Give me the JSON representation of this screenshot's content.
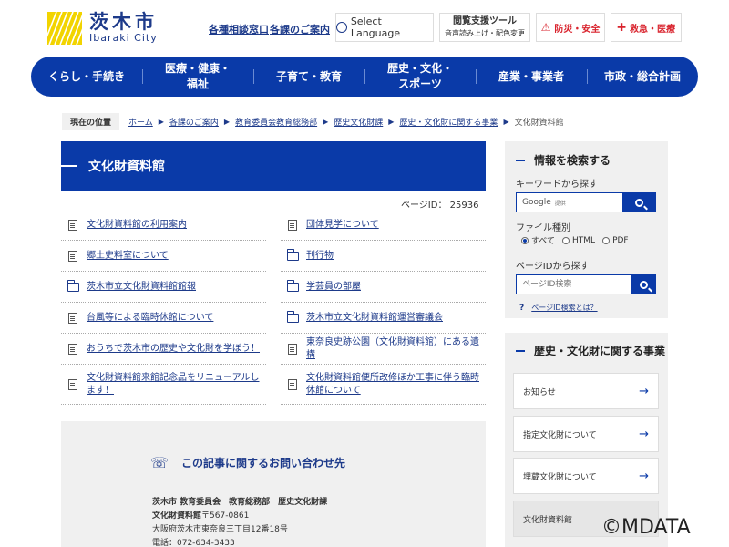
{
  "header": {
    "logo_jp": "茨木市",
    "logo_en": "Ibaraki City",
    "links": [
      "各種相談窓口",
      "各課のご案内"
    ],
    "select_language": "Select Language",
    "tool_line1": "閲覧支援ツール",
    "tool_line2": "音声読み上げ・配色変更",
    "safety": "防災・安全",
    "emergency": "救急・医療"
  },
  "nav": {
    "items": [
      "くらし・手続き",
      "医療・健康・\n福祉",
      "子育て・教育",
      "歴史・文化・\nスポーツ",
      "産業・事業者",
      "市政・総合計画"
    ]
  },
  "breadcrumb": {
    "here_label": "現在の位置",
    "links": [
      "ホーム",
      "各課のご案内",
      "教育委員会教育総務部",
      "歴史文化財課",
      "歴史・文化財に関する事業"
    ],
    "current": "文化財資料館"
  },
  "main": {
    "title": "文化財資料館",
    "page_id": "ページID： 25936",
    "links": [
      {
        "text": "文化財資料館の利用案内",
        "icon": "doc"
      },
      {
        "text": "団体見学について",
        "icon": "doc"
      },
      {
        "text": "郷土史料室について",
        "icon": "doc"
      },
      {
        "text": "刊行物",
        "icon": "folder"
      },
      {
        "text": "茨木市立文化財資料館館報",
        "icon": "folder"
      },
      {
        "text": "学芸員の部屋",
        "icon": "folder"
      },
      {
        "text": "台風等による臨時休館について",
        "icon": "doc"
      },
      {
        "text": "茨木市立文化財資料館運営審議会",
        "icon": "folder"
      },
      {
        "text": "おうちで茨木市の歴史や文化財を学ぼう！",
        "icon": "doc"
      },
      {
        "text": "東奈良史跡公園（文化財資料館）にある遺構",
        "icon": "doc"
      },
      {
        "text": "文化財資料館来館記念品をリニューアルします！",
        "icon": "doc"
      },
      {
        "text": "文化財資料館便所改修ほか工事に伴う臨時休館について",
        "icon": "doc"
      }
    ]
  },
  "contact": {
    "heading": "この記事に関するお問い合わせ先",
    "dept": "茨木市 教育委員会　教育総務部　歴史文化財課",
    "facility": "文化財資料館",
    "postal": "〒567-0861",
    "address": "大阪府茨木市東奈良三丁目12番18号",
    "phone": "電話：072-634-3433"
  },
  "sidebar": {
    "search_title": "情報を検索する",
    "keyword_label": "キーワードから探す",
    "google_label": "Google",
    "google_sub": "提供",
    "filetype_label": "ファイル種別",
    "filetypes": [
      "すべて",
      "HTML",
      "PDF"
    ],
    "selected_filetype": "すべて",
    "pageid_label": "ページIDから探す",
    "pageid_placeholder": "ページID検索",
    "pageid_help": "ページID検索とは？",
    "related_title": "歴史・文化財に関する事業",
    "related_items": [
      "お知らせ",
      "指定文化財について",
      "埋蔵文化財について",
      "文化財資料館"
    ]
  },
  "watermark": "©MDATA",
  "colors": {
    "primary": "#0a3aa8",
    "link": "#1d3a8a",
    "alert": "#d9232d",
    "panel": "#f0f0f0",
    "logo_yellow": "#f2d400"
  }
}
